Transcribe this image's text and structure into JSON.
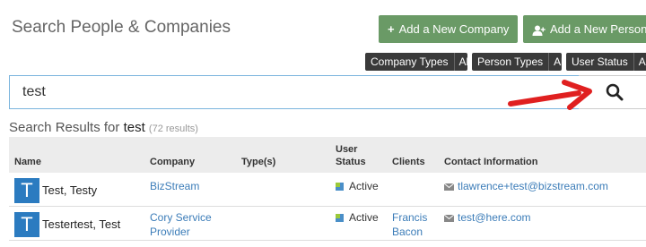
{
  "header": {
    "title": "Search People & Companies",
    "add_company_label": "Add a New Company",
    "add_person_label": "Add a New Person"
  },
  "filters": [
    {
      "label": "Company Types",
      "value": "All"
    },
    {
      "label": "Person Types",
      "value": "All"
    },
    {
      "label": "User Status",
      "value": "All"
    }
  ],
  "search": {
    "value": "test"
  },
  "results": {
    "prefix": "Search Results for",
    "query": "test",
    "count": "(72 results)"
  },
  "table": {
    "headers": {
      "name": "Name",
      "company": "Company",
      "types": "Type(s)",
      "status_line1": "User",
      "status_line2": "Status",
      "clients": "Clients",
      "contact": "Contact Information"
    },
    "rows": [
      {
        "avatar": "T",
        "name": "Test, Testy",
        "company": "BizStream",
        "company_line2": "",
        "types": "",
        "status": "Active",
        "clients": "",
        "clients_line2": "",
        "email": "tlawrence+test@bizstream.com"
      },
      {
        "avatar": "T",
        "name": "Testertest, Test",
        "company": "Cory Service",
        "company_line2": "Provider",
        "types": "",
        "status": "Active",
        "clients": "Francis",
        "clients_line2": "Bacon",
        "email": "test@here.com"
      }
    ]
  },
  "colors": {
    "green_button": "#6a9a66",
    "avatar": "#2b7bc0",
    "link": "#3b7cb8",
    "arrow": "#e02020"
  }
}
